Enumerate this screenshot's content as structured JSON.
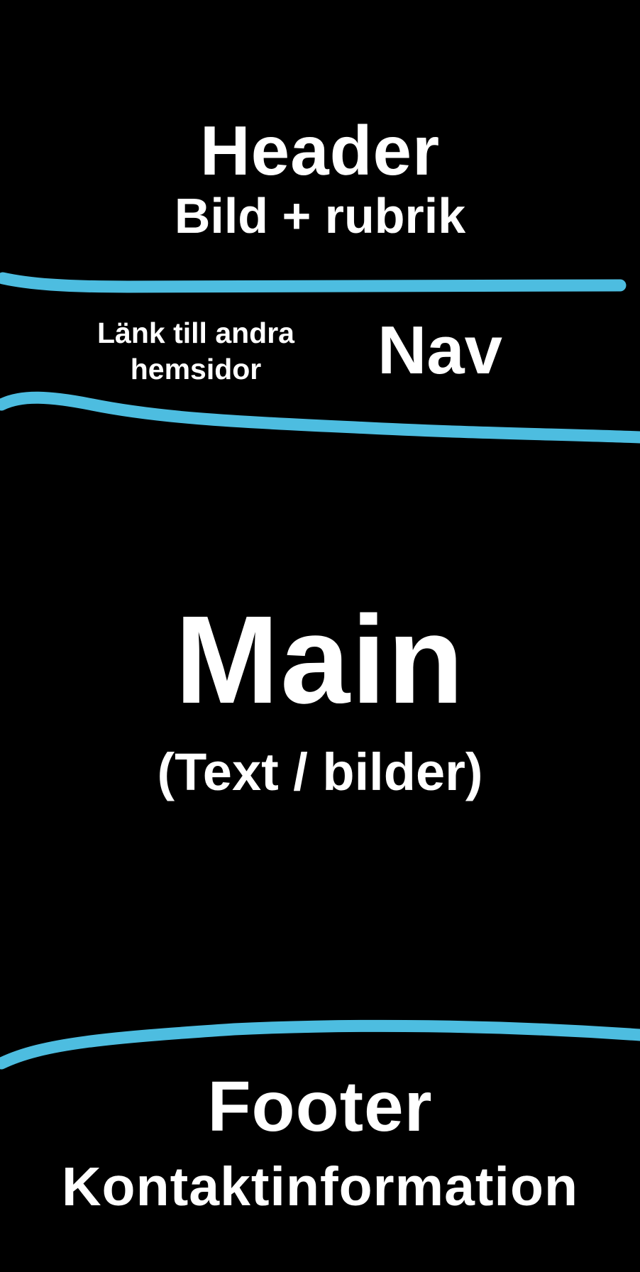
{
  "header": {
    "title": "Header",
    "subtitle": "Bild + rubrik"
  },
  "nav": {
    "title": "Nav",
    "description": "Länk till andra hemsidor"
  },
  "main": {
    "title": "Main",
    "subtitle": "(Text / bilder)"
  },
  "footer": {
    "title": "Footer",
    "subtitle": "Kontaktinformation"
  },
  "colors": {
    "background": "#000000",
    "text": "#ffffff",
    "divider": "#4dbde0"
  }
}
